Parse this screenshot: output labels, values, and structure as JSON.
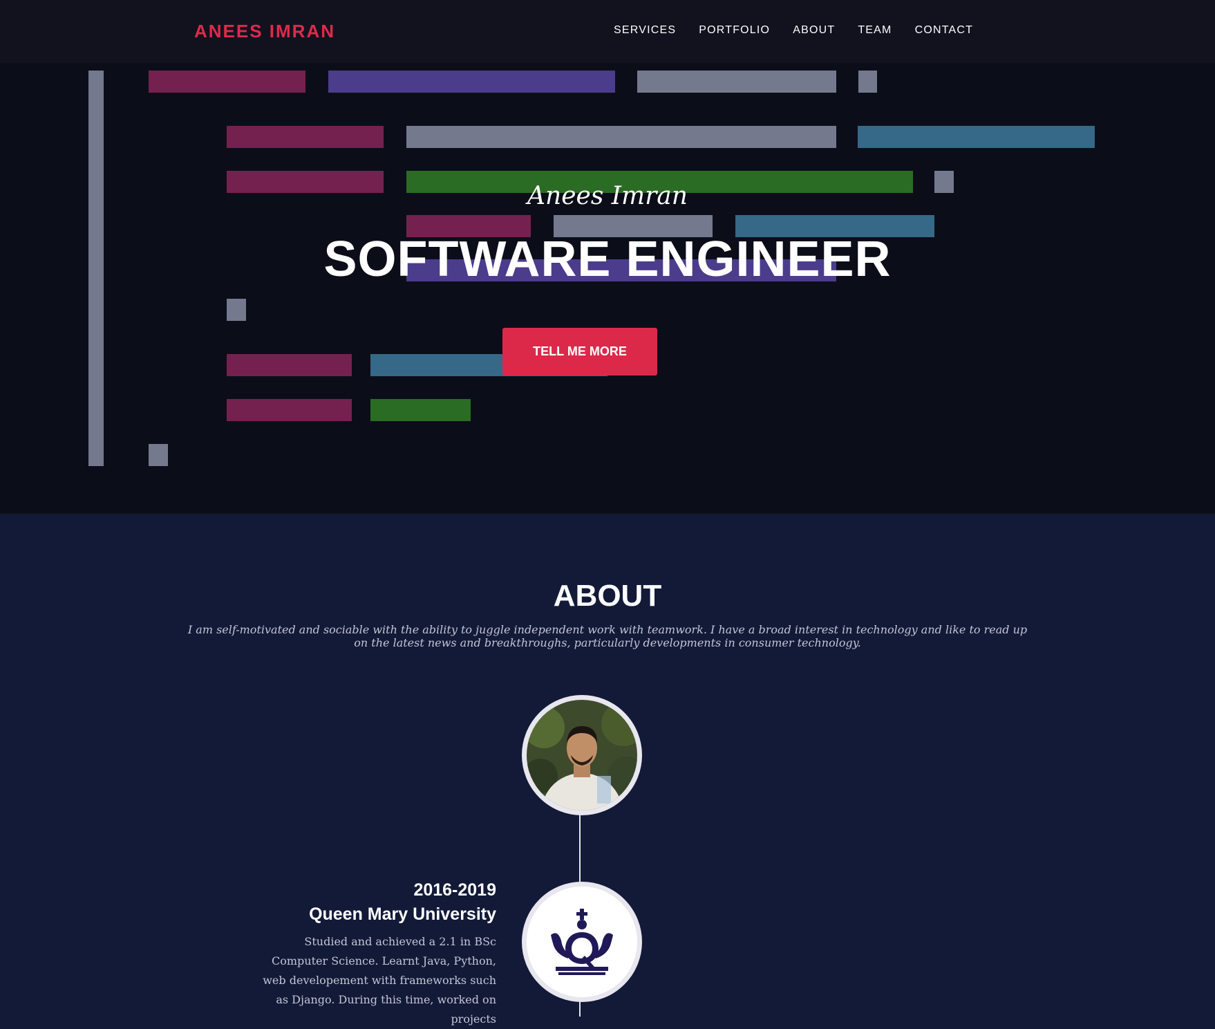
{
  "nav": {
    "brand": "ANEES IMRAN",
    "links": [
      "SERVICES",
      "PORTFOLIO",
      "ABOUT",
      "TEAM",
      "CONTACT"
    ]
  },
  "hero": {
    "subtitle": "Anees Imran",
    "title": "SOFTWARE ENGINEER",
    "button": "TELL ME MORE"
  },
  "about": {
    "title": "ABOUT",
    "description": "I am self-motivated and sociable with the ability to juggle independent work with teamwork. I have a broad interest in technology and like to read up on the latest news and breakthroughs, particularly developments in consumer technology.",
    "timeline": [
      {
        "years": "2016-2019",
        "name": "Queen Mary University",
        "text": "Studied and achieved a 2.1 in BSc Computer Science. Learnt Java, Python, web developement with frameworks such as Django. During this time, worked on projects"
      }
    ]
  },
  "colors": {
    "accent": "#df2a4b",
    "nav_bg": "#12121f",
    "hero_bg": "#0b0e19",
    "section_bg": "#131a38"
  },
  "icons": [
    "avatar-photo",
    "queen-mary-crown-logo"
  ]
}
